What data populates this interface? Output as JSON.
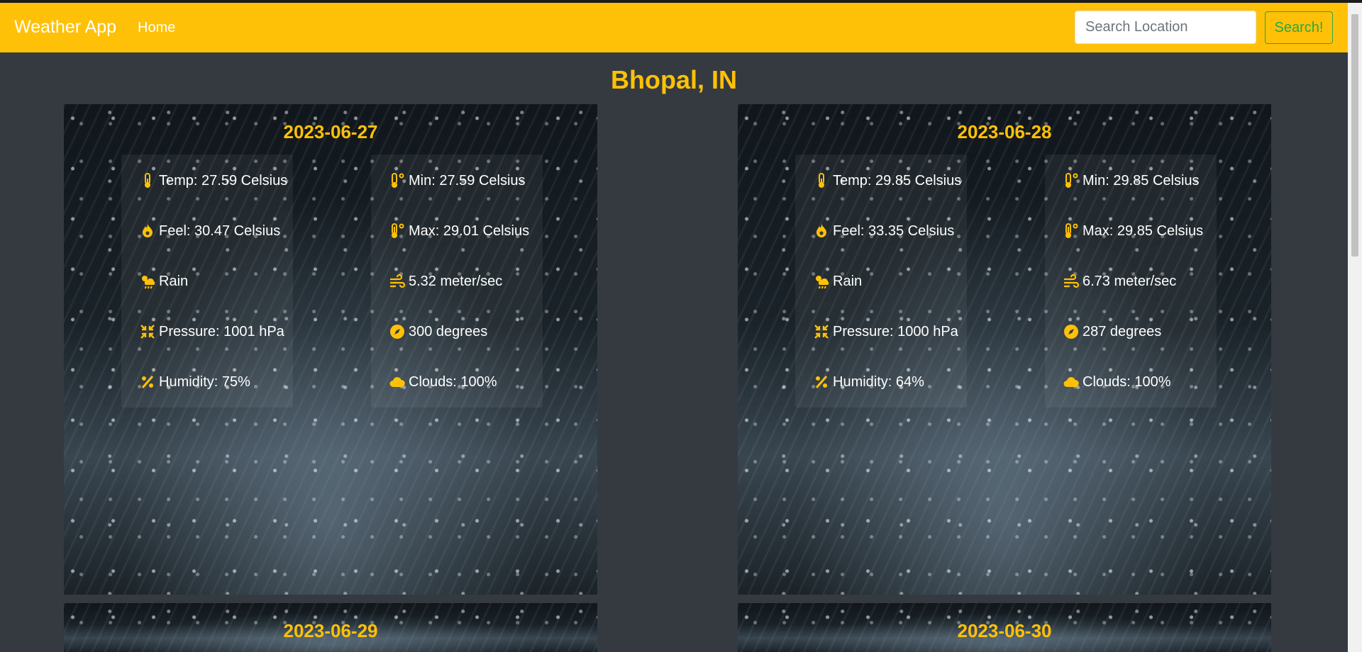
{
  "navbar": {
    "brand": "Weather App",
    "home": "Home",
    "search_placeholder": "Search Location",
    "search_button": "Search!"
  },
  "city": "Bhopal, IN",
  "colors": {
    "accent": "#ffc107",
    "background": "#343a40",
    "search_button": "#28a745"
  },
  "icons": {
    "temp": "thermometer-half-icon",
    "feel": "fire-icon",
    "weather": "cloud-sun-rain-icon",
    "pressure": "compress-icon",
    "humidity": "percent-icon",
    "min": "temperature-low-icon",
    "max": "temperature-high-icon",
    "wind": "wind-icon",
    "direction": "compass-icon",
    "clouds": "cloud-icon"
  },
  "forecasts": [
    {
      "date": "2023-06-27",
      "temp": "Temp: 27.59 Celsius",
      "feel": "Feel: 30.47 Celsius",
      "weather": "Rain",
      "pressure": "Pressure: 1001 hPa",
      "humidity": "Humidity: 75%",
      "min": "Min: 27.59 Celsius",
      "max": "Max: 29.01 Celsius",
      "wind": "5.32 meter/sec",
      "direction": "300 degrees",
      "clouds": "Clouds: 100%"
    },
    {
      "date": "2023-06-28",
      "temp": "Temp: 29.85 Celsius",
      "feel": "Feel: 33.35 Celsius",
      "weather": "Rain",
      "pressure": "Pressure: 1000 hPa",
      "humidity": "Humidity: 64%",
      "min": "Min: 29.85 Celsius",
      "max": "Max: 29.85 Celsius",
      "wind": "6.73 meter/sec",
      "direction": "287 degrees",
      "clouds": "Clouds: 100%"
    },
    {
      "date": "2023-06-29"
    },
    {
      "date": "2023-06-30"
    }
  ]
}
